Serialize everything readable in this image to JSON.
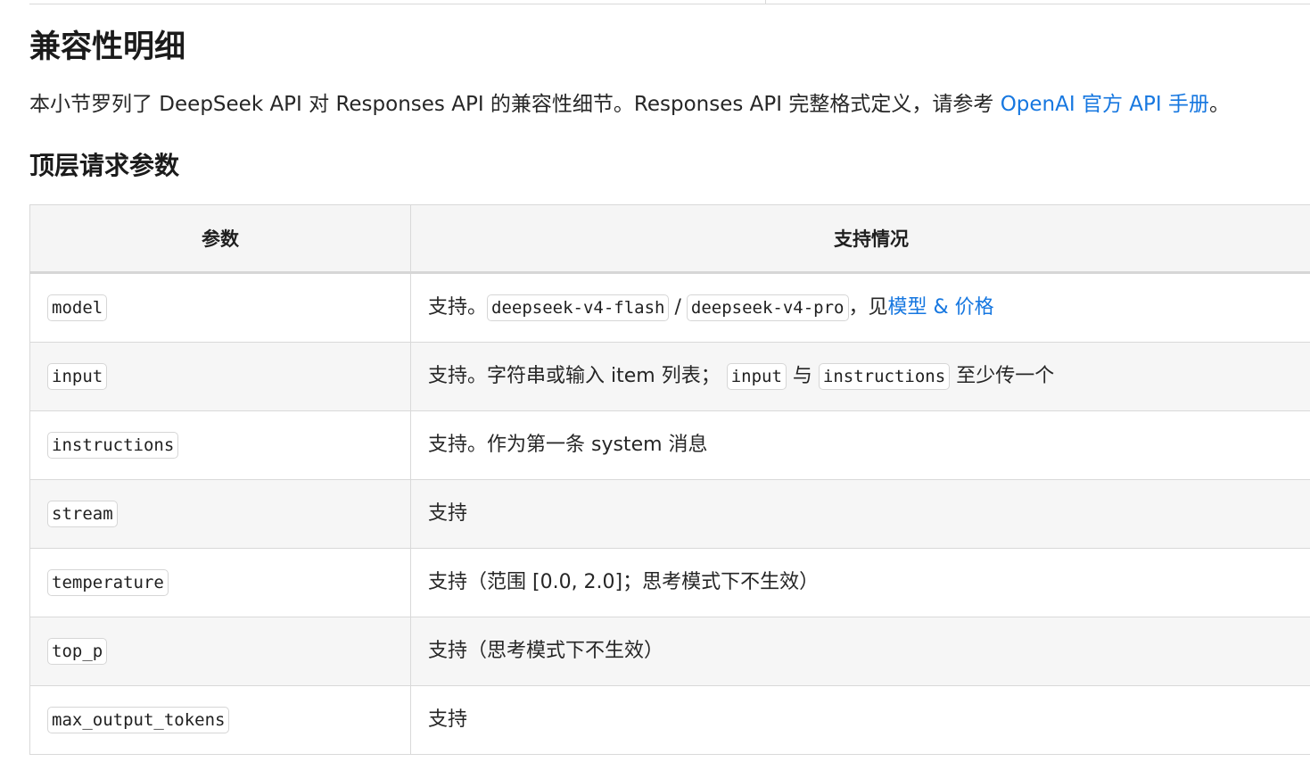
{
  "heading": "兼容性明细",
  "intro": {
    "text": "本小节罗列了 DeepSeek API 对 Responses API 的兼容性细节。Responses API 完整格式定义，请参考 ",
    "link": "OpenAI 官方 API 手册",
    "suffix": "。"
  },
  "subheading": "顶层请求参数",
  "table": {
    "headers": [
      "参数",
      "支持情况"
    ],
    "rows": [
      {
        "param": "model",
        "support": {
          "prefix": "支持。",
          "code1": "deepseek-v4-flash",
          "sep": "/",
          "code2": "deepseek-v4-pro",
          "mid": "，见",
          "link": "模型 & 价格"
        }
      },
      {
        "param": "input",
        "support": {
          "prefix": "支持。字符串或输入 item 列表；",
          "code1": "input",
          "mid": "与",
          "code2": "instructions",
          "suffix": "至少传一个"
        }
      },
      {
        "param": "instructions",
        "support": {
          "text": "支持。作为第一条 system 消息"
        }
      },
      {
        "param": "stream",
        "support": {
          "text": "支持"
        }
      },
      {
        "param": "temperature",
        "support": {
          "text": "支持（范围 [0.0, 2.0]；思考模式下不生效）"
        }
      },
      {
        "param": "top_p",
        "support": {
          "text": "支持（思考模式下不生效）"
        }
      },
      {
        "param": "max_output_tokens",
        "support": {
          "text": "支持"
        }
      }
    ]
  }
}
